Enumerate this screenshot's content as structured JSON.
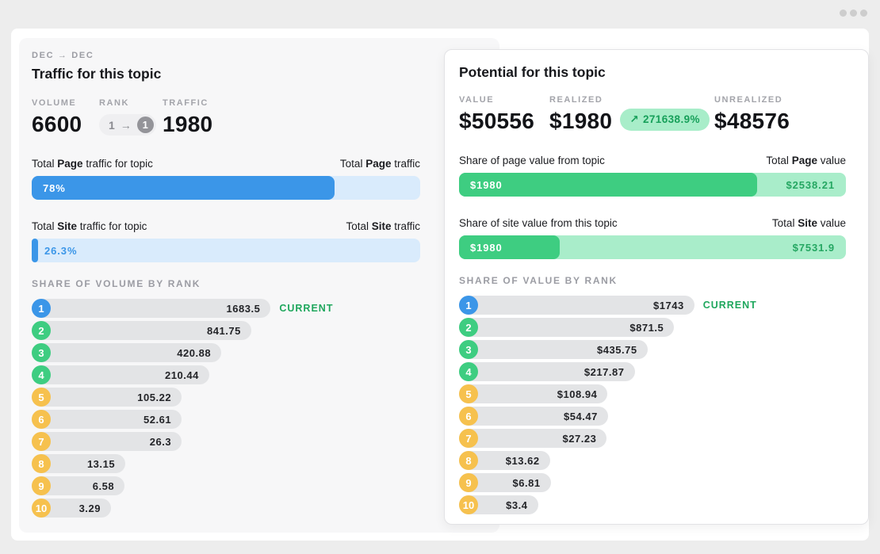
{
  "window": {
    "dot_color": "#cdcdcd"
  },
  "colors": {
    "accent_blue": "#3b96e8",
    "track_blue": "#d9ebfc",
    "accent_green": "#3ecd81",
    "track_green": "#a9edca",
    "green_value_text": "#25a762",
    "current_green": "#1fa75d",
    "badge_orange": "#f6c14e",
    "rank_track_gray": "#e3e4e6"
  },
  "left_panel": {
    "period": "DEC → DEC",
    "title": "Traffic for this topic",
    "stats": {
      "volume_label": "VOLUME",
      "volume_value": "6600",
      "rank_label": "RANK",
      "rank_from": "1",
      "rank_arrow": "→",
      "rank_to": "1",
      "traffic_label": "TRAFFIC",
      "traffic_value": "1980"
    },
    "page_bar": {
      "label_prefix": "Total ",
      "label_bold": "Page",
      "label_suffix": " traffic for topic",
      "right_prefix": "Total ",
      "right_bold": "Page",
      "right_suffix": " traffic",
      "fill_pct": 78,
      "fill_label": "78%"
    },
    "site_bar": {
      "label_prefix": "Total ",
      "label_bold": "Site",
      "label_suffix": " traffic for topic",
      "right_prefix": "Total ",
      "right_bold": "Site",
      "right_suffix": " traffic",
      "fill_pct": 1.6,
      "fill_label": "26.3%"
    },
    "rank_heading": "SHARE OF VOLUME BY RANK",
    "current_label": "CURRENT",
    "ranks": [
      {
        "rank": "1",
        "value": "1683.5",
        "width_pct": 61.5,
        "badge": "blue"
      },
      {
        "rank": "2",
        "value": "841.75",
        "width_pct": 56.5,
        "badge": "green"
      },
      {
        "rank": "3",
        "value": "420.88",
        "width_pct": 48.8,
        "badge": "green"
      },
      {
        "rank": "4",
        "value": "210.44",
        "width_pct": 45.7,
        "badge": "green"
      },
      {
        "rank": "5",
        "value": "105.22",
        "width_pct": 38.6,
        "badge": "orange"
      },
      {
        "rank": "6",
        "value": "52.61",
        "width_pct": 38.6,
        "badge": "orange"
      },
      {
        "rank": "7",
        "value": "26.3",
        "width_pct": 38.6,
        "badge": "orange"
      },
      {
        "rank": "8",
        "value": "13.15",
        "width_pct": 24.1,
        "badge": "orange"
      },
      {
        "rank": "9",
        "value": "6.58",
        "width_pct": 23.9,
        "badge": "orange"
      },
      {
        "rank": "10",
        "value": "3.29",
        "width_pct": 20.4,
        "badge": "orange"
      }
    ]
  },
  "right_panel": {
    "title": "Potential for this topic",
    "stats": {
      "value_label": "VALUE",
      "value_value": "$50556",
      "realized_label": "REALIZED",
      "realized_value": "$1980",
      "change_arrow": "↗",
      "change_value": "271638.9%",
      "unrealized_label": "UNREALIZED",
      "unrealized_value": "$48576"
    },
    "page_bar": {
      "label": "Share of page value from topic",
      "right_prefix": "Total ",
      "right_bold": "Page",
      "right_suffix": " value",
      "fill_pct": 77,
      "fill_label": "$1980",
      "total_label": "$2538.21"
    },
    "site_bar": {
      "label": "Share of site value from this topic",
      "right_prefix": "Total ",
      "right_bold": "Site",
      "right_suffix": " value",
      "fill_pct": 26,
      "fill_label": "$1980",
      "total_label": "$7531.9"
    },
    "rank_heading": "SHARE OF VALUE BY RANK",
    "current_label": "CURRENT",
    "ranks": [
      {
        "rank": "1",
        "value": "$1743",
        "width_pct": 60.8,
        "badge": "blue"
      },
      {
        "rank": "2",
        "value": "$871.5",
        "width_pct": 55.6,
        "badge": "green"
      },
      {
        "rank": "3",
        "value": "$435.75",
        "width_pct": 48.7,
        "badge": "green"
      },
      {
        "rank": "4",
        "value": "$217.87",
        "width_pct": 45.4,
        "badge": "green"
      },
      {
        "rank": "5",
        "value": "$108.94",
        "width_pct": 38.4,
        "badge": "orange"
      },
      {
        "rank": "6",
        "value": "$54.47",
        "width_pct": 38.5,
        "badge": "orange"
      },
      {
        "rank": "7",
        "value": "$27.23",
        "width_pct": 38.2,
        "badge": "orange"
      },
      {
        "rank": "8",
        "value": "$13.62",
        "width_pct": 23.5,
        "badge": "orange"
      },
      {
        "rank": "9",
        "value": "$6.81",
        "width_pct": 23.7,
        "badge": "orange"
      },
      {
        "rank": "10",
        "value": "$3.4",
        "width_pct": 20.4,
        "badge": "orange"
      }
    ]
  }
}
